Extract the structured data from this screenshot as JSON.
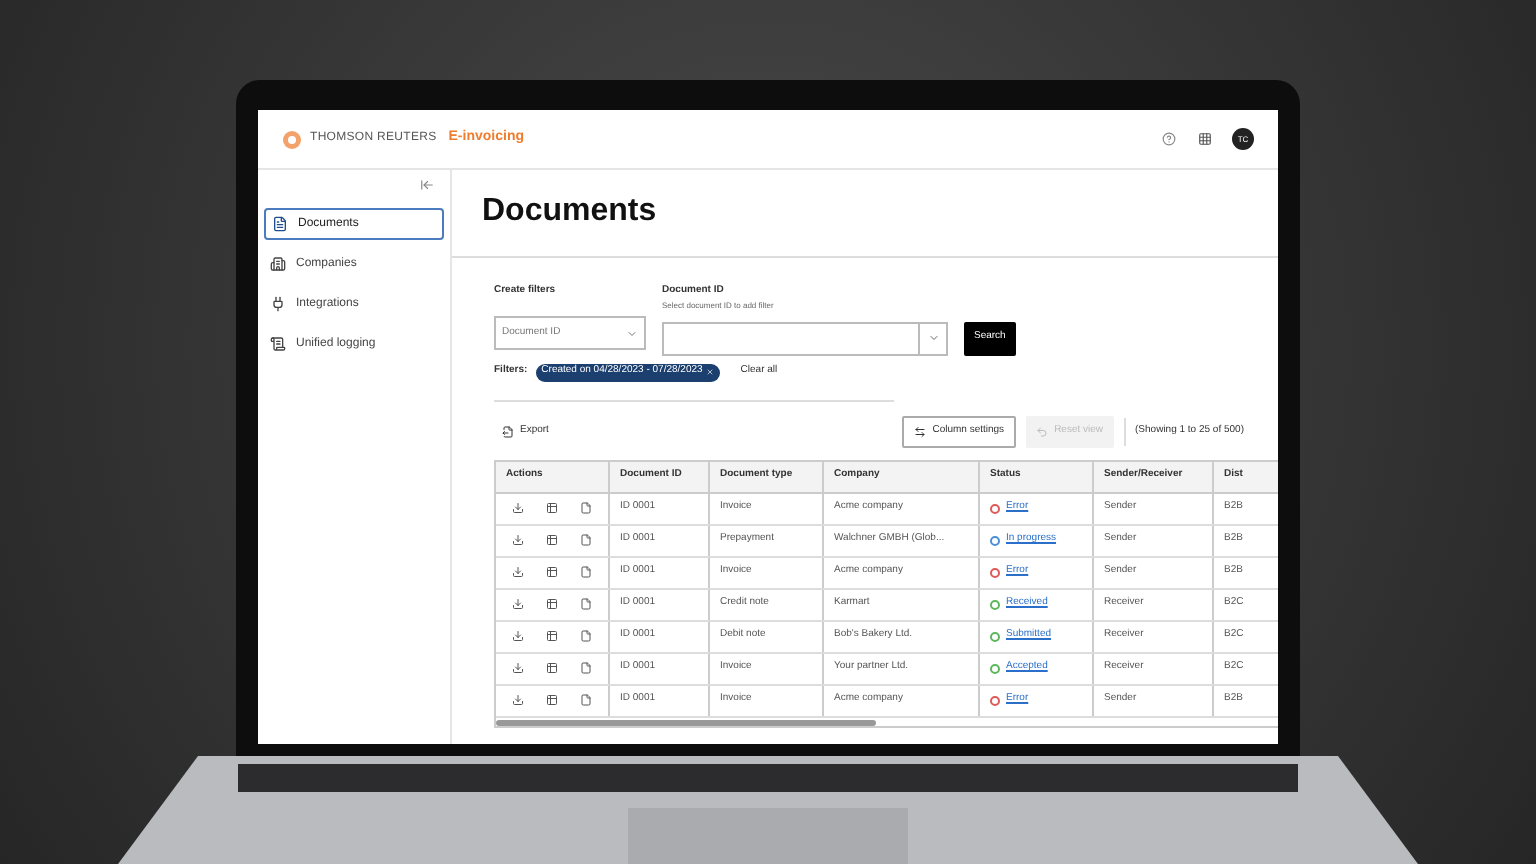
{
  "header": {
    "brand": "THOMSON REUTERS",
    "product": "E-invoicing",
    "avatar": "TC"
  },
  "sidebar": {
    "items": [
      {
        "label": "Documents",
        "selected": true
      },
      {
        "label": "Companies",
        "selected": false
      },
      {
        "label": "Integrations",
        "selected": false
      },
      {
        "label": "Unified logging",
        "selected": false
      }
    ]
  },
  "page": {
    "title": "Documents"
  },
  "filters": {
    "create_label": "Create filters",
    "select": {
      "value": "Document ID"
    },
    "field_label": "Document ID",
    "field_hint": "Select document ID to add filter",
    "search_button": "Search",
    "filters_label": "Filters:",
    "chip": "Created on 04/28/2023 - 07/28/2023",
    "clear_all": "Clear all"
  },
  "toolbar": {
    "export": "Export",
    "column_settings": "Column settings",
    "reset_view": "Reset view",
    "reset_disabled": true,
    "showing": "(Showing 1 to 25 of 500)"
  },
  "table": {
    "columns": [
      "Actions",
      "Document ID",
      "Document type",
      "Company",
      "Status",
      "Sender/Receiver",
      "Dist"
    ],
    "rows": [
      {
        "id": "ID 0001",
        "type": "Invoice",
        "company": "Acme company",
        "status": "Error",
        "color": "#e05a5a",
        "role": "Sender",
        "dist": "B2B"
      },
      {
        "id": "ID 0001",
        "type": "Prepayment",
        "company": "Walchner GMBH (Glob...",
        "status": "In progress",
        "color": "#4a90d9",
        "role": "Sender",
        "dist": "B2B"
      },
      {
        "id": "ID 0001",
        "type": "Invoice",
        "company": "Acme company",
        "status": "Error",
        "color": "#e05a5a",
        "role": "Sender",
        "dist": "B2B"
      },
      {
        "id": "ID 0001",
        "type": "Credit note",
        "company": "Karmart",
        "status": "Received",
        "color": "#5cb85c",
        "role": "Receiver",
        "dist": "B2C"
      },
      {
        "id": "ID 0001",
        "type": "Debit note",
        "company": "Bob's Bakery Ltd.",
        "status": "Submitted",
        "color": "#5cb85c",
        "role": "Receiver",
        "dist": "B2C"
      },
      {
        "id": "ID 0001",
        "type": "Invoice",
        "company": "Your partner Ltd.",
        "status": "Accepted",
        "color": "#5cb85c",
        "role": "Receiver",
        "dist": "B2C"
      },
      {
        "id": "ID 0001",
        "type": "Invoice",
        "company": "Acme company",
        "status": "Error",
        "color": "#e05a5a",
        "role": "Sender",
        "dist": "B2B"
      }
    ]
  }
}
